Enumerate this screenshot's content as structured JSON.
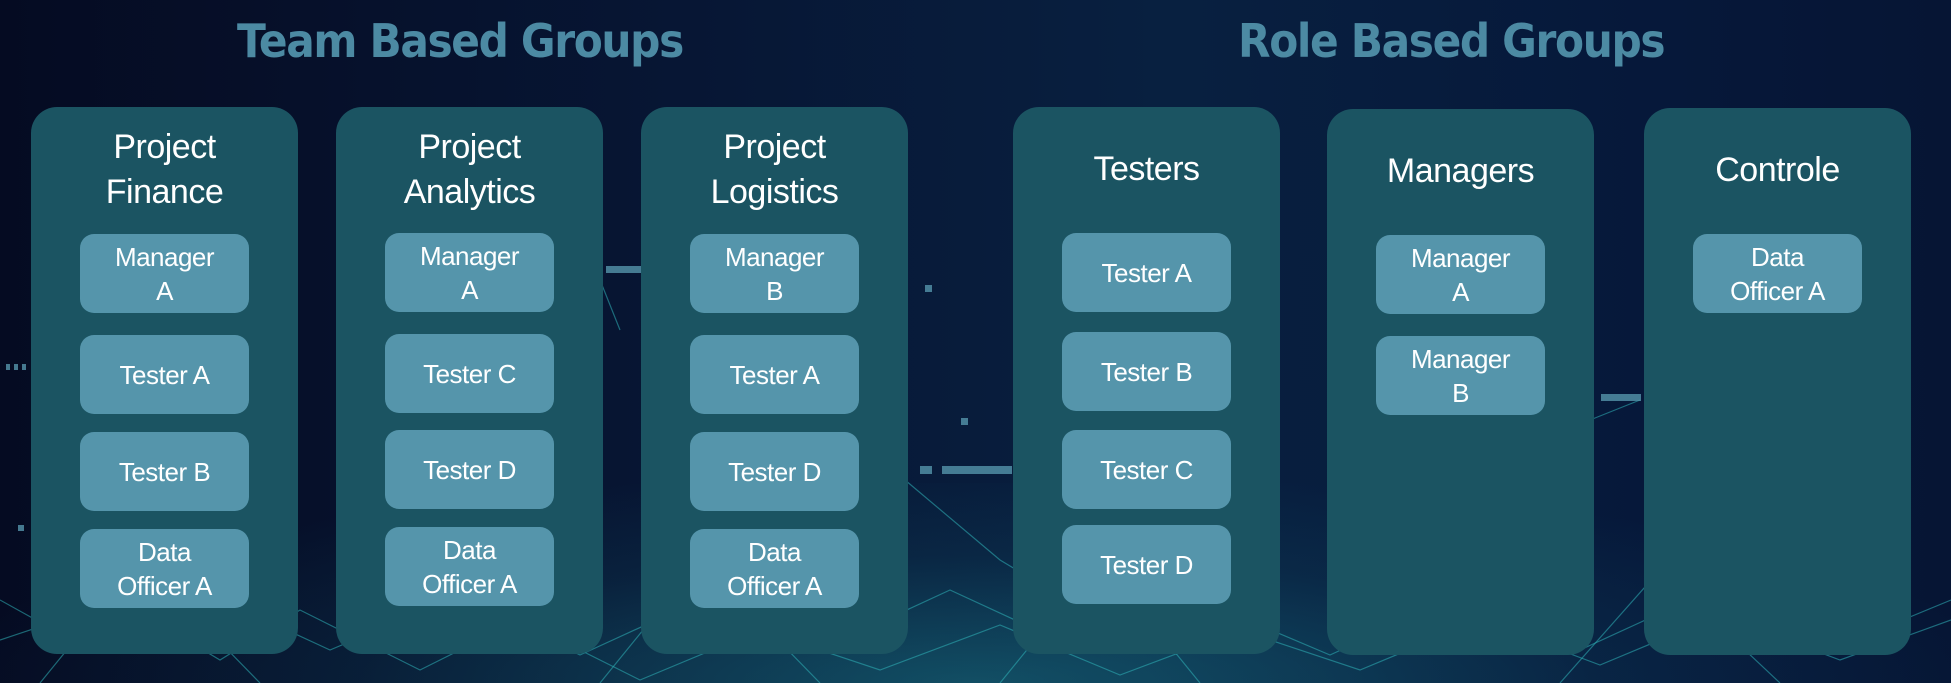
{
  "sections": {
    "team": {
      "title": "Team Based Groups",
      "groups": [
        {
          "name": "Project Finance",
          "members": [
            "Manager A",
            "Tester A",
            "Tester B",
            "Data Officer A"
          ]
        },
        {
          "name": "Project Analytics",
          "members": [
            "Manager A",
            "Tester C",
            "Tester D",
            "Data Officer A"
          ]
        },
        {
          "name": "Project Logistics",
          "members": [
            "Manager B",
            "Tester A",
            "Tester D",
            "Data Officer A"
          ]
        }
      ]
    },
    "role": {
      "title": "Role Based Groups",
      "groups": [
        {
          "name": "Testers",
          "members": [
            "Tester A",
            "Tester B",
            "Tester C",
            "Tester D"
          ]
        },
        {
          "name": "Managers",
          "members": [
            "Manager A",
            "Manager B"
          ]
        },
        {
          "name": "Controle",
          "members": [
            "Data Officer A"
          ]
        }
      ]
    }
  },
  "colors": {
    "background": "#061534",
    "title": "#4c8aa3",
    "panel": "#1b5462",
    "card": "#5595ab",
    "text": "#ffffff"
  }
}
